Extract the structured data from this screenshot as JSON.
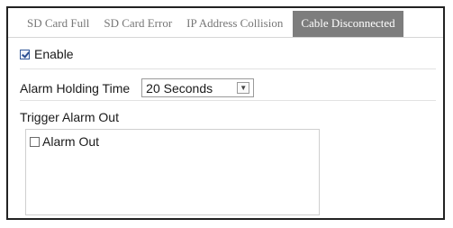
{
  "tabs": [
    {
      "label": "SD Card Full",
      "active": false
    },
    {
      "label": "SD Card Error",
      "active": false
    },
    {
      "label": "IP Address Collision",
      "active": false
    },
    {
      "label": "Cable Disconnected",
      "active": true
    }
  ],
  "enable": {
    "label": "Enable",
    "checked": true
  },
  "holding_time": {
    "label": "Alarm Holding Time",
    "value": "20 Seconds"
  },
  "trigger": {
    "label": "Trigger Alarm Out"
  },
  "alarm_out": {
    "label": "Alarm Out",
    "checked": false
  }
}
